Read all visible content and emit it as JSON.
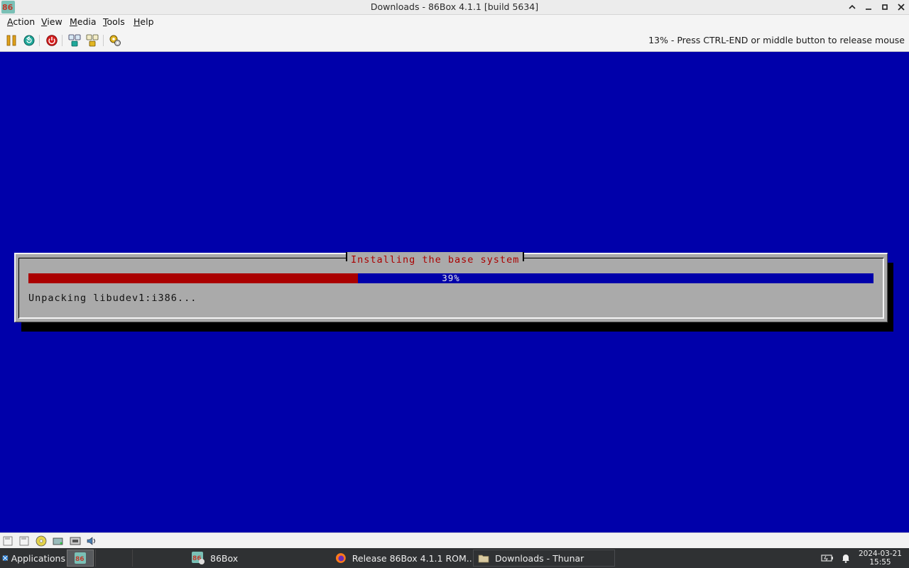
{
  "window": {
    "title": "Downloads - 86Box 4.1.1 [build 5634]"
  },
  "menu": {
    "items": [
      {
        "label": "Action",
        "accel": "A",
        "rest": "ction"
      },
      {
        "label": "View",
        "accel": "V",
        "rest": "iew"
      },
      {
        "label": "Media",
        "accel": "M",
        "rest": "edia"
      },
      {
        "label": "Tools",
        "accel": "T",
        "rest": "ools"
      },
      {
        "label": "Help",
        "accel": "H",
        "rest": "elp"
      }
    ]
  },
  "toolbar": {
    "status_message": "13% - Press CTRL-END or middle button to release mouse",
    "icons": [
      "pause-icon",
      "reset-icon",
      "power-icon",
      "ctrl-alt-del-icon",
      "ctrl-alt-esc-icon",
      "settings-icon"
    ]
  },
  "installer": {
    "dialog_title": "Installing the base system",
    "progress_percent": 39,
    "progress_label": "39%",
    "status_text": "Unpacking libudev1:i386..."
  },
  "colors": {
    "screen_bg": "#0000aa",
    "dialog_bg": "#aaaaaa",
    "progress_fill": "#aa0000",
    "title_text": "#aa0000"
  },
  "taskbar": {
    "applications_label": "Applications",
    "tasks": [
      {
        "label": "86Box",
        "active": false
      },
      {
        "label": "Release 86Box 4.1.1 ROM...",
        "active": false
      },
      {
        "label": "Downloads - Thunar",
        "active": false
      }
    ],
    "clock_date": "2024-03-21",
    "clock_time": "15:55"
  }
}
